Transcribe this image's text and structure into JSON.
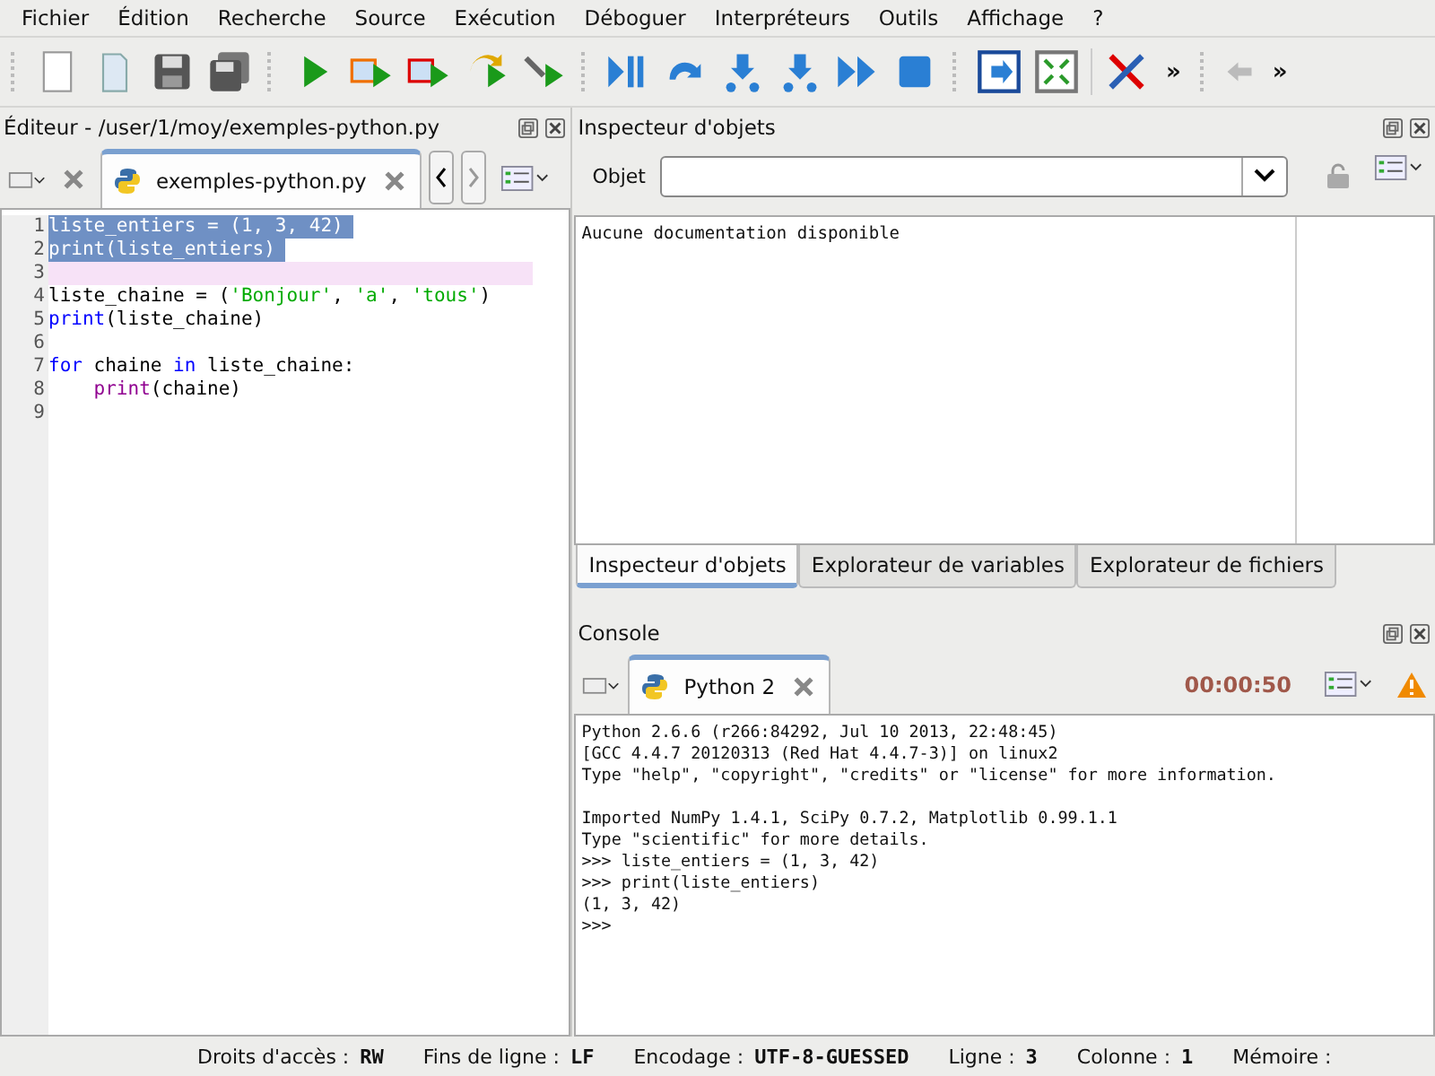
{
  "menu": [
    "Fichier",
    "Édition",
    "Recherche",
    "Source",
    "Exécution",
    "Déboguer",
    "Interpréteurs",
    "Outils",
    "Affichage",
    "?"
  ],
  "toolbar": {
    "overflow": [
      "»",
      "»"
    ]
  },
  "editor": {
    "title": "Éditeur - /user/1/moy/exemples-python.py",
    "tab": {
      "label": "exemples-python.py",
      "selected": true
    },
    "lines": [
      {
        "number": "1",
        "selected": true,
        "current": false,
        "tokens": [
          {
            "kind": "plain",
            "text": "liste_entiers = (1, 3, 42)"
          }
        ]
      },
      {
        "number": "2",
        "selected": true,
        "current": false,
        "tokens": [
          {
            "kind": "plain",
            "text": "print(liste_entiers)"
          }
        ]
      },
      {
        "number": "3",
        "selected": false,
        "current": true
      },
      {
        "number": "4",
        "selected": false,
        "current": false,
        "tokens": [
          {
            "kind": "plain",
            "text": "liste_chaine = ("
          },
          {
            "kind": "string",
            "text": "'Bonjour'"
          },
          {
            "kind": "plain",
            "text": ", "
          },
          {
            "kind": "string",
            "text": "'a'"
          },
          {
            "kind": "plain",
            "text": ", "
          },
          {
            "kind": "string",
            "text": "'tous'"
          },
          {
            "kind": "plain",
            "text": ")"
          }
        ]
      },
      {
        "number": "5",
        "selected": false,
        "current": false,
        "tokens": [
          {
            "kind": "keyword",
            "text": "print"
          },
          {
            "kind": "plain",
            "text": "(liste_chaine)"
          }
        ]
      },
      {
        "number": "6",
        "selected": false,
        "current": false
      },
      {
        "number": "7",
        "selected": false,
        "current": false,
        "tokens": [
          {
            "kind": "keyword",
            "text": "for"
          },
          {
            "kind": "plain",
            "text": " chaine "
          },
          {
            "kind": "keyword",
            "text": "in"
          },
          {
            "kind": "plain",
            "text": " liste_chaine:"
          }
        ]
      },
      {
        "number": "8",
        "selected": false,
        "current": false,
        "tokens": [
          {
            "kind": "builtin",
            "text": "    print"
          },
          {
            "kind": "plain",
            "text": "(chaine)"
          }
        ]
      },
      {
        "number": "9",
        "selected": false,
        "current": false
      }
    ]
  },
  "inspector": {
    "title": "Inspecteur d'objets",
    "object_label": "Objet",
    "doc": "Aucune documentation disponible",
    "tabs": [
      {
        "label": "Inspecteur d'objets",
        "selected": true
      },
      {
        "label": "Explorateur de variables",
        "selected": false
      },
      {
        "label": "Explorateur de fichiers",
        "selected": false
      }
    ]
  },
  "console": {
    "title": "Console",
    "tab": {
      "label": "Python 2",
      "selected": true
    },
    "timer": "00:00:50",
    "output": [
      [
        "Python 2.6.6 (r266:84292, Jul 10 2013, 22:48:45)",
        "[GCC 4.4.7 20120313 (Red Hat 4.4.7-3)] on linux2",
        "Type \"help\", \"copyright\", \"credits\" or \"license\" for more information."
      ],
      [
        "Imported NumPy 1.4.1, SciPy 0.7.2, Matplotlib 0.99.1.1",
        "Type \"scientific\" for more details.",
        ">>> liste_entiers = (1, 3, 42)",
        ">>> print(liste_entiers)",
        "(1, 3, 42)",
        ">>>"
      ]
    ]
  },
  "status_bar": [
    {
      "label": "Droits d'accès :",
      "value": "RW"
    },
    {
      "label": "Fins de ligne :",
      "value": "LF"
    },
    {
      "label": "Encodage :",
      "value": "UTF-8-GUESSED"
    },
    {
      "label": "Ligne :",
      "value": "3"
    },
    {
      "label": "Colonne :",
      "value": "1"
    },
    {
      "label": "Mémoire :"
    }
  ]
}
